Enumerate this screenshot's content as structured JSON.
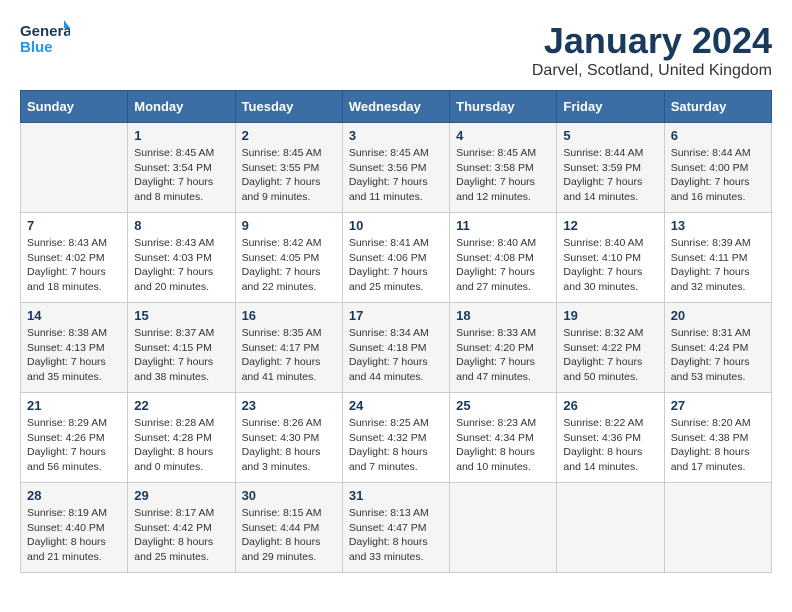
{
  "logo": {
    "text_general": "General",
    "text_blue": "Blue"
  },
  "title": "January 2024",
  "location": "Darvel, Scotland, United Kingdom",
  "days_of_week": [
    "Sunday",
    "Monday",
    "Tuesday",
    "Wednesday",
    "Thursday",
    "Friday",
    "Saturday"
  ],
  "weeks": [
    [
      {
        "day": "",
        "info": ""
      },
      {
        "day": "1",
        "info": "Sunrise: 8:45 AM\nSunset: 3:54 PM\nDaylight: 7 hours\nand 8 minutes."
      },
      {
        "day": "2",
        "info": "Sunrise: 8:45 AM\nSunset: 3:55 PM\nDaylight: 7 hours\nand 9 minutes."
      },
      {
        "day": "3",
        "info": "Sunrise: 8:45 AM\nSunset: 3:56 PM\nDaylight: 7 hours\nand 11 minutes."
      },
      {
        "day": "4",
        "info": "Sunrise: 8:45 AM\nSunset: 3:58 PM\nDaylight: 7 hours\nand 12 minutes."
      },
      {
        "day": "5",
        "info": "Sunrise: 8:44 AM\nSunset: 3:59 PM\nDaylight: 7 hours\nand 14 minutes."
      },
      {
        "day": "6",
        "info": "Sunrise: 8:44 AM\nSunset: 4:00 PM\nDaylight: 7 hours\nand 16 minutes."
      }
    ],
    [
      {
        "day": "7",
        "info": "Sunrise: 8:43 AM\nSunset: 4:02 PM\nDaylight: 7 hours\nand 18 minutes."
      },
      {
        "day": "8",
        "info": "Sunrise: 8:43 AM\nSunset: 4:03 PM\nDaylight: 7 hours\nand 20 minutes."
      },
      {
        "day": "9",
        "info": "Sunrise: 8:42 AM\nSunset: 4:05 PM\nDaylight: 7 hours\nand 22 minutes."
      },
      {
        "day": "10",
        "info": "Sunrise: 8:41 AM\nSunset: 4:06 PM\nDaylight: 7 hours\nand 25 minutes."
      },
      {
        "day": "11",
        "info": "Sunrise: 8:40 AM\nSunset: 4:08 PM\nDaylight: 7 hours\nand 27 minutes."
      },
      {
        "day": "12",
        "info": "Sunrise: 8:40 AM\nSunset: 4:10 PM\nDaylight: 7 hours\nand 30 minutes."
      },
      {
        "day": "13",
        "info": "Sunrise: 8:39 AM\nSunset: 4:11 PM\nDaylight: 7 hours\nand 32 minutes."
      }
    ],
    [
      {
        "day": "14",
        "info": "Sunrise: 8:38 AM\nSunset: 4:13 PM\nDaylight: 7 hours\nand 35 minutes."
      },
      {
        "day": "15",
        "info": "Sunrise: 8:37 AM\nSunset: 4:15 PM\nDaylight: 7 hours\nand 38 minutes."
      },
      {
        "day": "16",
        "info": "Sunrise: 8:35 AM\nSunset: 4:17 PM\nDaylight: 7 hours\nand 41 minutes."
      },
      {
        "day": "17",
        "info": "Sunrise: 8:34 AM\nSunset: 4:18 PM\nDaylight: 7 hours\nand 44 minutes."
      },
      {
        "day": "18",
        "info": "Sunrise: 8:33 AM\nSunset: 4:20 PM\nDaylight: 7 hours\nand 47 minutes."
      },
      {
        "day": "19",
        "info": "Sunrise: 8:32 AM\nSunset: 4:22 PM\nDaylight: 7 hours\nand 50 minutes."
      },
      {
        "day": "20",
        "info": "Sunrise: 8:31 AM\nSunset: 4:24 PM\nDaylight: 7 hours\nand 53 minutes."
      }
    ],
    [
      {
        "day": "21",
        "info": "Sunrise: 8:29 AM\nSunset: 4:26 PM\nDaylight: 7 hours\nand 56 minutes."
      },
      {
        "day": "22",
        "info": "Sunrise: 8:28 AM\nSunset: 4:28 PM\nDaylight: 8 hours\nand 0 minutes."
      },
      {
        "day": "23",
        "info": "Sunrise: 8:26 AM\nSunset: 4:30 PM\nDaylight: 8 hours\nand 3 minutes."
      },
      {
        "day": "24",
        "info": "Sunrise: 8:25 AM\nSunset: 4:32 PM\nDaylight: 8 hours\nand 7 minutes."
      },
      {
        "day": "25",
        "info": "Sunrise: 8:23 AM\nSunset: 4:34 PM\nDaylight: 8 hours\nand 10 minutes."
      },
      {
        "day": "26",
        "info": "Sunrise: 8:22 AM\nSunset: 4:36 PM\nDaylight: 8 hours\nand 14 minutes."
      },
      {
        "day": "27",
        "info": "Sunrise: 8:20 AM\nSunset: 4:38 PM\nDaylight: 8 hours\nand 17 minutes."
      }
    ],
    [
      {
        "day": "28",
        "info": "Sunrise: 8:19 AM\nSunset: 4:40 PM\nDaylight: 8 hours\nand 21 minutes."
      },
      {
        "day": "29",
        "info": "Sunrise: 8:17 AM\nSunset: 4:42 PM\nDaylight: 8 hours\nand 25 minutes."
      },
      {
        "day": "30",
        "info": "Sunrise: 8:15 AM\nSunset: 4:44 PM\nDaylight: 8 hours\nand 29 minutes."
      },
      {
        "day": "31",
        "info": "Sunrise: 8:13 AM\nSunset: 4:47 PM\nDaylight: 8 hours\nand 33 minutes."
      },
      {
        "day": "",
        "info": ""
      },
      {
        "day": "",
        "info": ""
      },
      {
        "day": "",
        "info": ""
      }
    ]
  ]
}
